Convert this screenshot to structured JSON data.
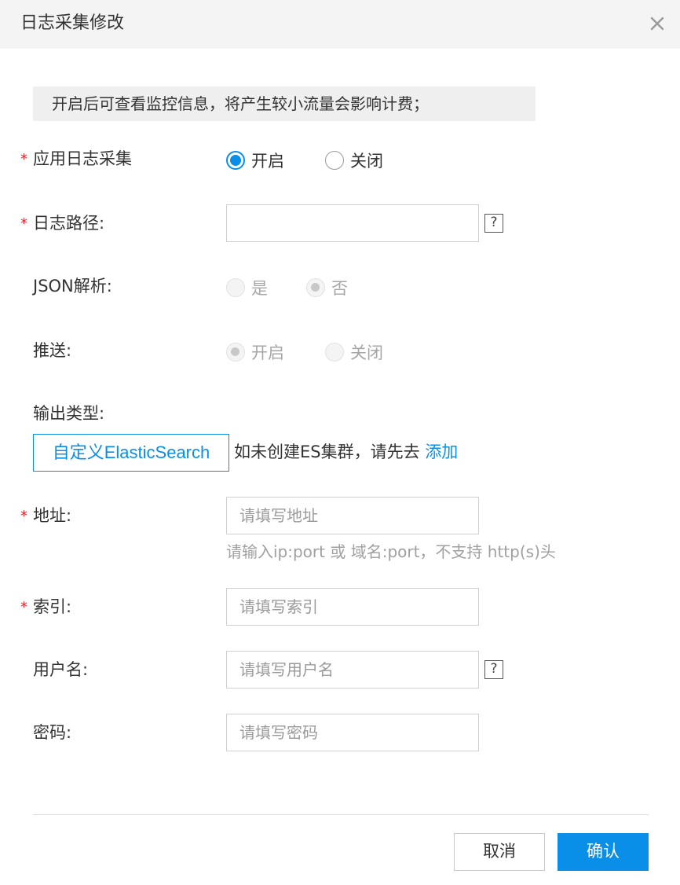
{
  "dialog": {
    "title": "日志采集修改",
    "close_icon": "close-icon"
  },
  "notice": "开启后可查看监控信息，将产生较小流量会影响计费；",
  "required_mark": "*",
  "app_log": {
    "label": "应用日志采集",
    "options": [
      {
        "label": "开启",
        "checked": true,
        "disabled": false
      },
      {
        "label": "关闭",
        "checked": false,
        "disabled": false
      }
    ]
  },
  "log_path": {
    "label": "日志路径:",
    "value": "",
    "help_icon": "?"
  },
  "json_parse": {
    "label": "JSON解析:",
    "options": [
      {
        "label": "是",
        "checked": false,
        "disabled": true
      },
      {
        "label": "否",
        "checked": true,
        "disabled": true
      }
    ]
  },
  "push": {
    "label": "推送:",
    "options": [
      {
        "label": "开启",
        "checked": true,
        "disabled": true
      },
      {
        "label": "关闭",
        "checked": false,
        "disabled": true
      }
    ]
  },
  "output_type": {
    "label": "输出类型:",
    "button_label": "自定义ElasticSearch",
    "hint": "如未创建ES集群，请先去",
    "link": "添加"
  },
  "address": {
    "label": "地址:",
    "placeholder": "请填写地址",
    "hint": "请输入ip:port 或 域名:port，不支持 http(s)头"
  },
  "index": {
    "label": "索引:",
    "placeholder": "请填写索引"
  },
  "username": {
    "label": "用户名:",
    "placeholder": "请填写用户名",
    "help_icon": "?"
  },
  "password": {
    "label": "密码:",
    "placeholder": "请填写密码"
  },
  "footer": {
    "cancel_label": "取消",
    "confirm_label": "确认"
  },
  "colors": {
    "accent": "#0a8fe8",
    "required": "#e0282e",
    "header_bg": "#f4f4f4"
  }
}
